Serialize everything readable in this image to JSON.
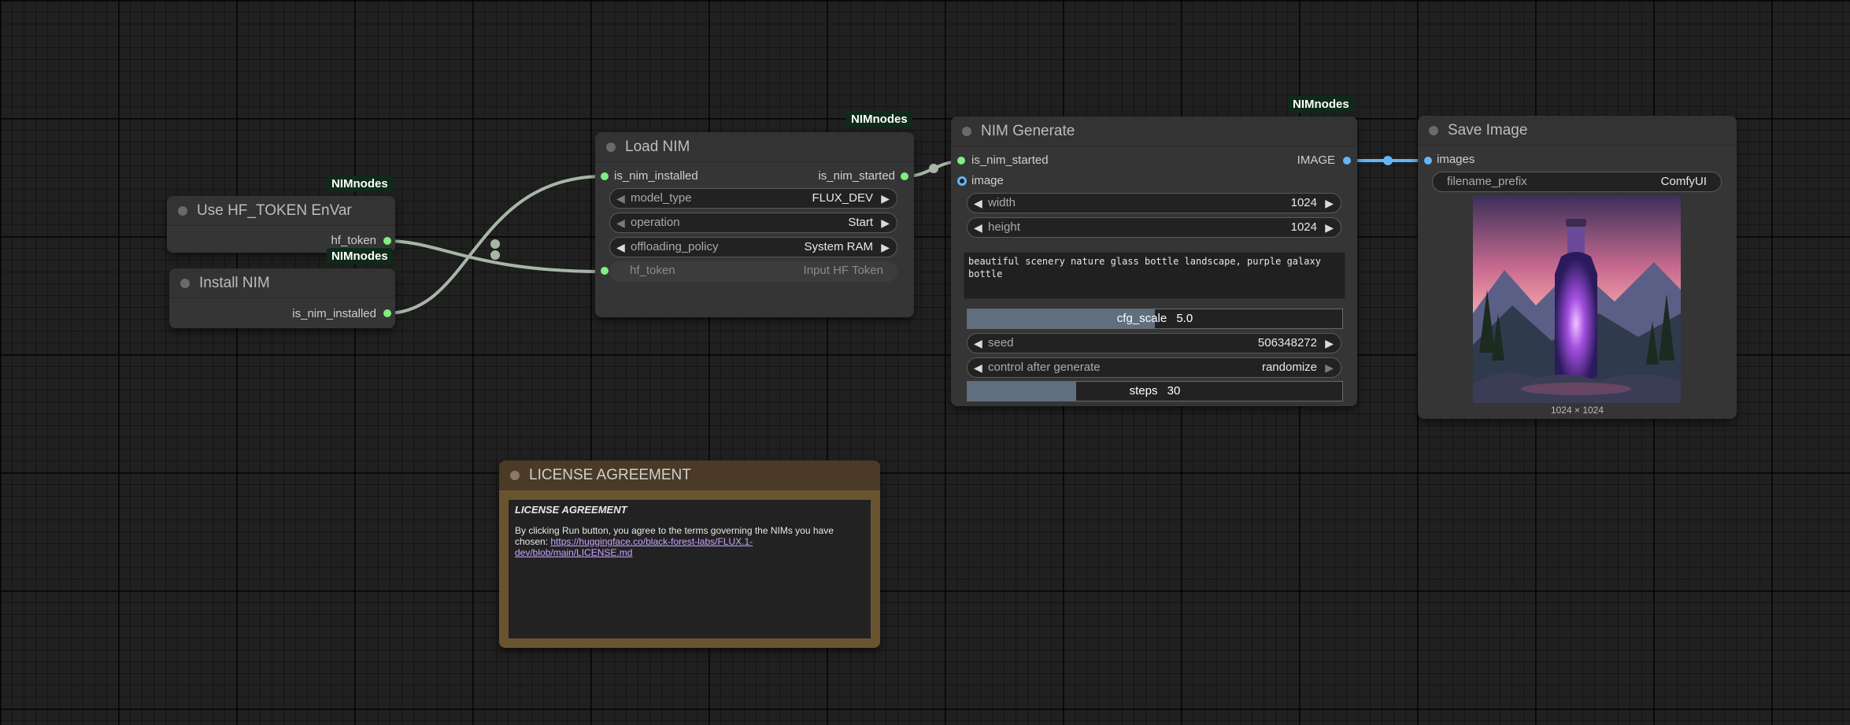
{
  "colors": {
    "canvas": "#202020",
    "node_bg": "#353535",
    "badge_bg": "#0e2a18",
    "link_green": "#a7b6a6",
    "link_blue": "#64b5f6",
    "license_bg": "#4a3a26",
    "license_border": "#6a5430"
  },
  "nodes": {
    "hf_token": {
      "badge": "NIMnodes",
      "title": "Use HF_TOKEN EnVar",
      "output": "hf_token"
    },
    "install_nim": {
      "badge": "NIMnodes",
      "title": "Install NIM",
      "output": "is_nim_installed"
    },
    "load_nim": {
      "badge": "NIMnodes",
      "title": "Load NIM",
      "input": "is_nim_installed",
      "output": "is_nim_started",
      "model_type": {
        "label": "model_type",
        "value": "FLUX_DEV"
      },
      "operation": {
        "label": "operation",
        "value": "Start"
      },
      "offloading_policy": {
        "label": "offloading_policy",
        "value": "System RAM"
      },
      "hf_token": {
        "label": "hf_token",
        "value": "Input HF Token"
      }
    },
    "nim_generate": {
      "badge": "NIMnodes",
      "title": "NIM Generate",
      "input1": "is_nim_started",
      "input2": "image",
      "output": "IMAGE",
      "width": {
        "label": "width",
        "value": "1024"
      },
      "height": {
        "label": "height",
        "value": "1024"
      },
      "prompt": "beautiful scenery nature glass bottle landscape, purple galaxy bottle",
      "cfg_scale": {
        "label": "cfg_scale",
        "value": "5.0",
        "fill": 0.5
      },
      "seed": {
        "label": "seed",
        "value": "506348272"
      },
      "control": {
        "label": "control after generate",
        "value": "randomize"
      },
      "steps": {
        "label": "steps",
        "value": "30",
        "fill": 0.29
      }
    },
    "save_image": {
      "title": "Save Image",
      "input": "images",
      "filename_prefix": {
        "label": "filename_prefix",
        "value": "ComfyUI"
      },
      "image_size": "1024 × 1024"
    },
    "license": {
      "title": "LICENSE AGREEMENT",
      "heading": "LICENSE AGREEMENT",
      "body": "By clicking Run button, you agree to the terms governing the NIMs you have chosen: ",
      "link": "https://huggingface.co/black-forest-labs/FLUX.1-dev/blob/main/LICENSE.md"
    }
  }
}
